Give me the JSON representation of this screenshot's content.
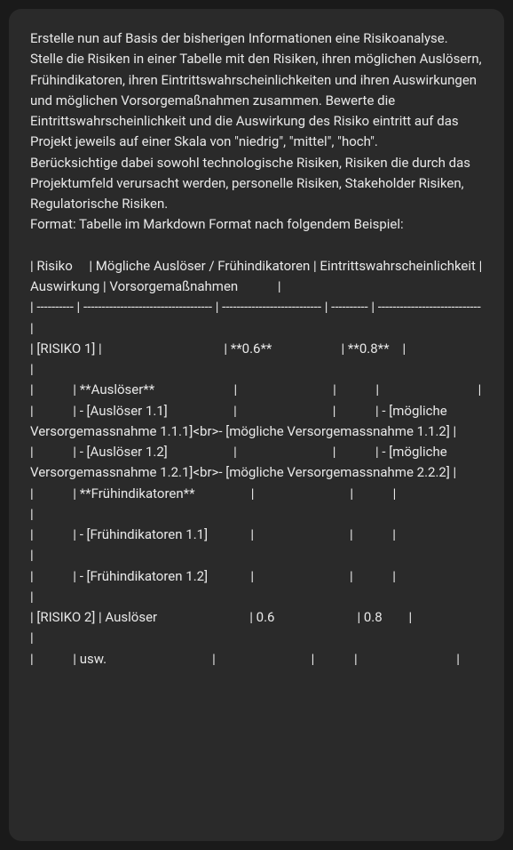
{
  "message": {
    "para1": "Erstelle nun auf Basis der bisherigen Informationen eine Risikoanalyse. Stelle die Risiken in einer Tabelle mit den Risiken, ihren möglichen Auslösern, Frühindikatoren, ihren Eintrittswahrscheinlichkeiten und ihren Auswirkungen und möglichen Vorsorgemaßnahmen zusammen. Bewerte die Eintrittswahrscheinlichkeit und die Auswirkung des Risiko eintritt auf das Projekt jeweils auf einer Skala von \"niedrig\", \"mittel\", \"hoch\".",
    "para2": "Berücksichtige dabei sowohl technologische Risiken, Risiken die durch das Projektumfeld verursacht werden, personelle Risiken, Stakeholder Risiken, Regulatorische Risiken.",
    "para3": "Format: Tabelle im Markdown Format nach folgendem Beispiel:",
    "table_header": "| Risiko     | Mögliche Auslöser / Frühindikatoren | Eintrittswahrscheinlichkeit | Auswirkung | Vorsorgemaßnahmen            |",
    "table_divider": "| ---------- | ----------------------------------- | --------------------------- | ---------- | ---------------------------- |",
    "row_risiko1": "| [RISIKO 1] |                                     | **0.6**                     | **0.8**    |                              |",
    "row_ausloeser_header": "|            | **Auslöser**                        |                             |            |                              |",
    "row_ausloeser_11": "|            | - [Auslöser 1.1]                    |                             |            | - [mögliche Versorgemassnahme 1.1.1]<br>- [mögliche Versorgemassnahme 1.1.2] |",
    "row_ausloeser_12": "|            | - [Auslöser 1.2]                    |                             |            | - [mögliche Versorgemassnahme 1.2.1]<br>- [mögliche Versorgemassnahme 2.2.2] |",
    "row_fruehindikatoren_header": "|            | **Frühindikatoren**                 |                             |            |                              |",
    "row_fruehindikatoren_11": "|            | - [Frühindikatoren 1.1]             |                             |            |                              |",
    "row_fruehindikatoren_12": "|            | - [Frühindikatoren 1.2]             |                             |            |                              |",
    "row_risiko2": "| [RISIKO 2] | Auslöser                            | 0.6                         | 0.8        |                              |",
    "row_usw": "|            | usw.                                |                             |            |                              |"
  }
}
